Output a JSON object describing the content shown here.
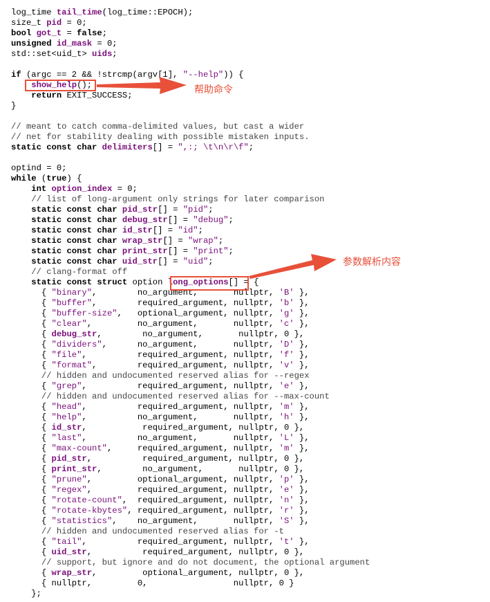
{
  "annotations": {
    "help_command": "帮助命令",
    "parse_content": "参数解析内容"
  },
  "colors": {
    "accent": "#e8503a",
    "identifier": "#7a0f7a"
  },
  "code": [
    [
      [
        "t",
        "log_time "
      ],
      [
        "idb",
        "tail_time"
      ],
      [
        "t",
        "(log_time::EPOCH);"
      ]
    ],
    [
      [
        "t",
        "size_t "
      ],
      [
        "idb",
        "pid"
      ],
      [
        "t",
        " = 0;"
      ]
    ],
    [
      [
        "kw",
        "bool "
      ],
      [
        "idb",
        "got_t"
      ],
      [
        "t",
        " = "
      ],
      [
        "kw",
        "false"
      ],
      [
        "t",
        ";"
      ]
    ],
    [
      [
        "kw",
        "unsigned "
      ],
      [
        "idb",
        "id_mask"
      ],
      [
        "t",
        " = 0;"
      ]
    ],
    [
      [
        "t",
        "std::set<uid_t> "
      ],
      [
        "idb",
        "uids"
      ],
      [
        "t",
        ";"
      ]
    ],
    [],
    [
      [
        "kw",
        "if"
      ],
      [
        "t",
        " (argc == 2 && !strcmp(argv[1], "
      ],
      [
        "str",
        "\"--help\""
      ],
      [
        "t",
        ")) {"
      ]
    ],
    [
      [
        "t",
        "    "
      ],
      [
        "idb",
        "show_help"
      ],
      [
        "t",
        "();"
      ]
    ],
    [
      [
        "t",
        "    "
      ],
      [
        "kw",
        "return"
      ],
      [
        "t",
        " EXIT_SUCCESS;"
      ]
    ],
    [
      [
        "t",
        "}"
      ]
    ],
    [],
    [
      [
        "cm",
        "// meant to catch comma-delimited values, but cast a wider"
      ]
    ],
    [
      [
        "cm",
        "// net for stability dealing with possible mistaken inputs."
      ]
    ],
    [
      [
        "kw",
        "static const char "
      ],
      [
        "idb",
        "delimiters"
      ],
      [
        "t",
        "[] = "
      ],
      [
        "str",
        "\",:; \\t\\n\\r\\f\""
      ],
      [
        "t",
        ";"
      ]
    ],
    [],
    [
      [
        "t",
        "optind = 0;"
      ]
    ],
    [
      [
        "kw",
        "while"
      ],
      [
        "t",
        " ("
      ],
      [
        "kw",
        "true"
      ],
      [
        "t",
        ") {"
      ]
    ],
    [
      [
        "t",
        "    "
      ],
      [
        "kw",
        "int "
      ],
      [
        "idb",
        "option_index"
      ],
      [
        "t",
        " = 0;"
      ]
    ],
    [
      [
        "cm",
        "    // list of long-argument only strings for later comparison"
      ]
    ],
    [
      [
        "t",
        "    "
      ],
      [
        "kw",
        "static const char "
      ],
      [
        "idb",
        "pid_str"
      ],
      [
        "t",
        "[] = "
      ],
      [
        "str",
        "\"pid\""
      ],
      [
        "t",
        ";"
      ]
    ],
    [
      [
        "t",
        "    "
      ],
      [
        "kw",
        "static const char "
      ],
      [
        "idb",
        "debug_str"
      ],
      [
        "t",
        "[] = "
      ],
      [
        "str",
        "\"debug\""
      ],
      [
        "t",
        ";"
      ]
    ],
    [
      [
        "t",
        "    "
      ],
      [
        "kw",
        "static const char "
      ],
      [
        "idb",
        "id_str"
      ],
      [
        "t",
        "[] = "
      ],
      [
        "str",
        "\"id\""
      ],
      [
        "t",
        ";"
      ]
    ],
    [
      [
        "t",
        "    "
      ],
      [
        "kw",
        "static const char "
      ],
      [
        "idb",
        "wrap_str"
      ],
      [
        "t",
        "[] = "
      ],
      [
        "str",
        "\"wrap\""
      ],
      [
        "t",
        ";"
      ]
    ],
    [
      [
        "t",
        "    "
      ],
      [
        "kw",
        "static const char "
      ],
      [
        "idb",
        "print_str"
      ],
      [
        "t",
        "[] = "
      ],
      [
        "str",
        "\"print\""
      ],
      [
        "t",
        ";"
      ]
    ],
    [
      [
        "t",
        "    "
      ],
      [
        "kw",
        "static const char "
      ],
      [
        "idb",
        "uid_str"
      ],
      [
        "t",
        "[] = "
      ],
      [
        "str",
        "\"uid\""
      ],
      [
        "t",
        ";"
      ]
    ],
    [
      [
        "cm",
        "    // clang-format off"
      ]
    ],
    [
      [
        "t",
        "    "
      ],
      [
        "kw",
        "static const struct "
      ],
      [
        "t",
        "option "
      ],
      [
        "idb",
        "long_options"
      ],
      [
        "t",
        "[] = {"
      ]
    ],
    [
      [
        "t",
        "      { "
      ],
      [
        "str",
        "\"binary\""
      ],
      [
        "t",
        ",        no_argument,       nullptr, "
      ],
      [
        "str",
        "'B'"
      ],
      [
        "t",
        " },"
      ]
    ],
    [
      [
        "t",
        "      { "
      ],
      [
        "str",
        "\"buffer\""
      ],
      [
        "t",
        ",        required_argument, nullptr, "
      ],
      [
        "str",
        "'b'"
      ],
      [
        "t",
        " },"
      ]
    ],
    [
      [
        "t",
        "      { "
      ],
      [
        "str",
        "\"buffer-size\""
      ],
      [
        "t",
        ",   optional_argument, nullptr, "
      ],
      [
        "str",
        "'g'"
      ],
      [
        "t",
        " },"
      ]
    ],
    [
      [
        "t",
        "      { "
      ],
      [
        "str",
        "\"clear\""
      ],
      [
        "t",
        ",         no_argument,       nullptr, "
      ],
      [
        "str",
        "'c'"
      ],
      [
        "t",
        " },"
      ]
    ],
    [
      [
        "t",
        "      { "
      ],
      [
        "idb",
        "debug_str"
      ],
      [
        "t",
        ",        no_argument,       nullptr, 0 },"
      ]
    ],
    [
      [
        "t",
        "      { "
      ],
      [
        "str",
        "\"dividers\""
      ],
      [
        "t",
        ",      no_argument,       nullptr, "
      ],
      [
        "str",
        "'D'"
      ],
      [
        "t",
        " },"
      ]
    ],
    [
      [
        "t",
        "      { "
      ],
      [
        "str",
        "\"file\""
      ],
      [
        "t",
        ",          required_argument, nullptr, "
      ],
      [
        "str",
        "'f'"
      ],
      [
        "t",
        " },"
      ]
    ],
    [
      [
        "t",
        "      { "
      ],
      [
        "str",
        "\"format\""
      ],
      [
        "t",
        ",        required_argument, nullptr, "
      ],
      [
        "str",
        "'v'"
      ],
      [
        "t",
        " },"
      ]
    ],
    [
      [
        "cm",
        "      // hidden and undocumented reserved alias for --regex"
      ]
    ],
    [
      [
        "t",
        "      { "
      ],
      [
        "str",
        "\"grep\""
      ],
      [
        "t",
        ",          required_argument, nullptr, "
      ],
      [
        "str",
        "'e'"
      ],
      [
        "t",
        " },"
      ]
    ],
    [
      [
        "cm",
        "      // hidden and undocumented reserved alias for --max-count"
      ]
    ],
    [
      [
        "t",
        "      { "
      ],
      [
        "str",
        "\"head\""
      ],
      [
        "t",
        ",          required_argument, nullptr, "
      ],
      [
        "str",
        "'m'"
      ],
      [
        "t",
        " },"
      ]
    ],
    [
      [
        "t",
        "      { "
      ],
      [
        "str",
        "\"help\""
      ],
      [
        "t",
        ",          no_argument,       nullptr, "
      ],
      [
        "str",
        "'h'"
      ],
      [
        "t",
        " },"
      ]
    ],
    [
      [
        "t",
        "      { "
      ],
      [
        "idb",
        "id_str"
      ],
      [
        "t",
        ",           required_argument, nullptr, 0 },"
      ]
    ],
    [
      [
        "t",
        "      { "
      ],
      [
        "str",
        "\"last\""
      ],
      [
        "t",
        ",          no_argument,       nullptr, "
      ],
      [
        "str",
        "'L'"
      ],
      [
        "t",
        " },"
      ]
    ],
    [
      [
        "t",
        "      { "
      ],
      [
        "str",
        "\"max-count\""
      ],
      [
        "t",
        ",     required_argument, nullptr, "
      ],
      [
        "str",
        "'m'"
      ],
      [
        "t",
        " },"
      ]
    ],
    [
      [
        "t",
        "      { "
      ],
      [
        "idb",
        "pid_str"
      ],
      [
        "t",
        ",          required_argument, nullptr, 0 },"
      ]
    ],
    [
      [
        "t",
        "      { "
      ],
      [
        "idb",
        "print_str"
      ],
      [
        "t",
        ",        no_argument,       nullptr, 0 },"
      ]
    ],
    [
      [
        "t",
        "      { "
      ],
      [
        "str",
        "\"prune\""
      ],
      [
        "t",
        ",         optional_argument, nullptr, "
      ],
      [
        "str",
        "'p'"
      ],
      [
        "t",
        " },"
      ]
    ],
    [
      [
        "t",
        "      { "
      ],
      [
        "str",
        "\"regex\""
      ],
      [
        "t",
        ",         required_argument, nullptr, "
      ],
      [
        "str",
        "'e'"
      ],
      [
        "t",
        " },"
      ]
    ],
    [
      [
        "t",
        "      { "
      ],
      [
        "str",
        "\"rotate-count\""
      ],
      [
        "t",
        ",  required_argument, nullptr, "
      ],
      [
        "str",
        "'n'"
      ],
      [
        "t",
        " },"
      ]
    ],
    [
      [
        "t",
        "      { "
      ],
      [
        "str",
        "\"rotate-kbytes\""
      ],
      [
        "t",
        ", required_argument, nullptr, "
      ],
      [
        "str",
        "'r'"
      ],
      [
        "t",
        " },"
      ]
    ],
    [
      [
        "t",
        "      { "
      ],
      [
        "str",
        "\"statistics\""
      ],
      [
        "t",
        ",    no_argument,       nullptr, "
      ],
      [
        "str",
        "'S'"
      ],
      [
        "t",
        " },"
      ]
    ],
    [
      [
        "cm",
        "      // hidden and undocumented reserved alias for -t"
      ]
    ],
    [
      [
        "t",
        "      { "
      ],
      [
        "str",
        "\"tail\""
      ],
      [
        "t",
        ",          required_argument, nullptr, "
      ],
      [
        "str",
        "'t'"
      ],
      [
        "t",
        " },"
      ]
    ],
    [
      [
        "t",
        "      { "
      ],
      [
        "idb",
        "uid_str"
      ],
      [
        "t",
        ",          required_argument, nullptr, 0 },"
      ]
    ],
    [
      [
        "cm",
        "      // support, but ignore and do not document, the optional argument"
      ]
    ],
    [
      [
        "t",
        "      { "
      ],
      [
        "idb",
        "wrap_str"
      ],
      [
        "t",
        ",         optional_argument, nullptr, 0 },"
      ]
    ],
    [
      [
        "t",
        "      { nullptr,         0,                 nullptr, 0 }"
      ]
    ],
    [
      [
        "t",
        "    };"
      ]
    ]
  ]
}
